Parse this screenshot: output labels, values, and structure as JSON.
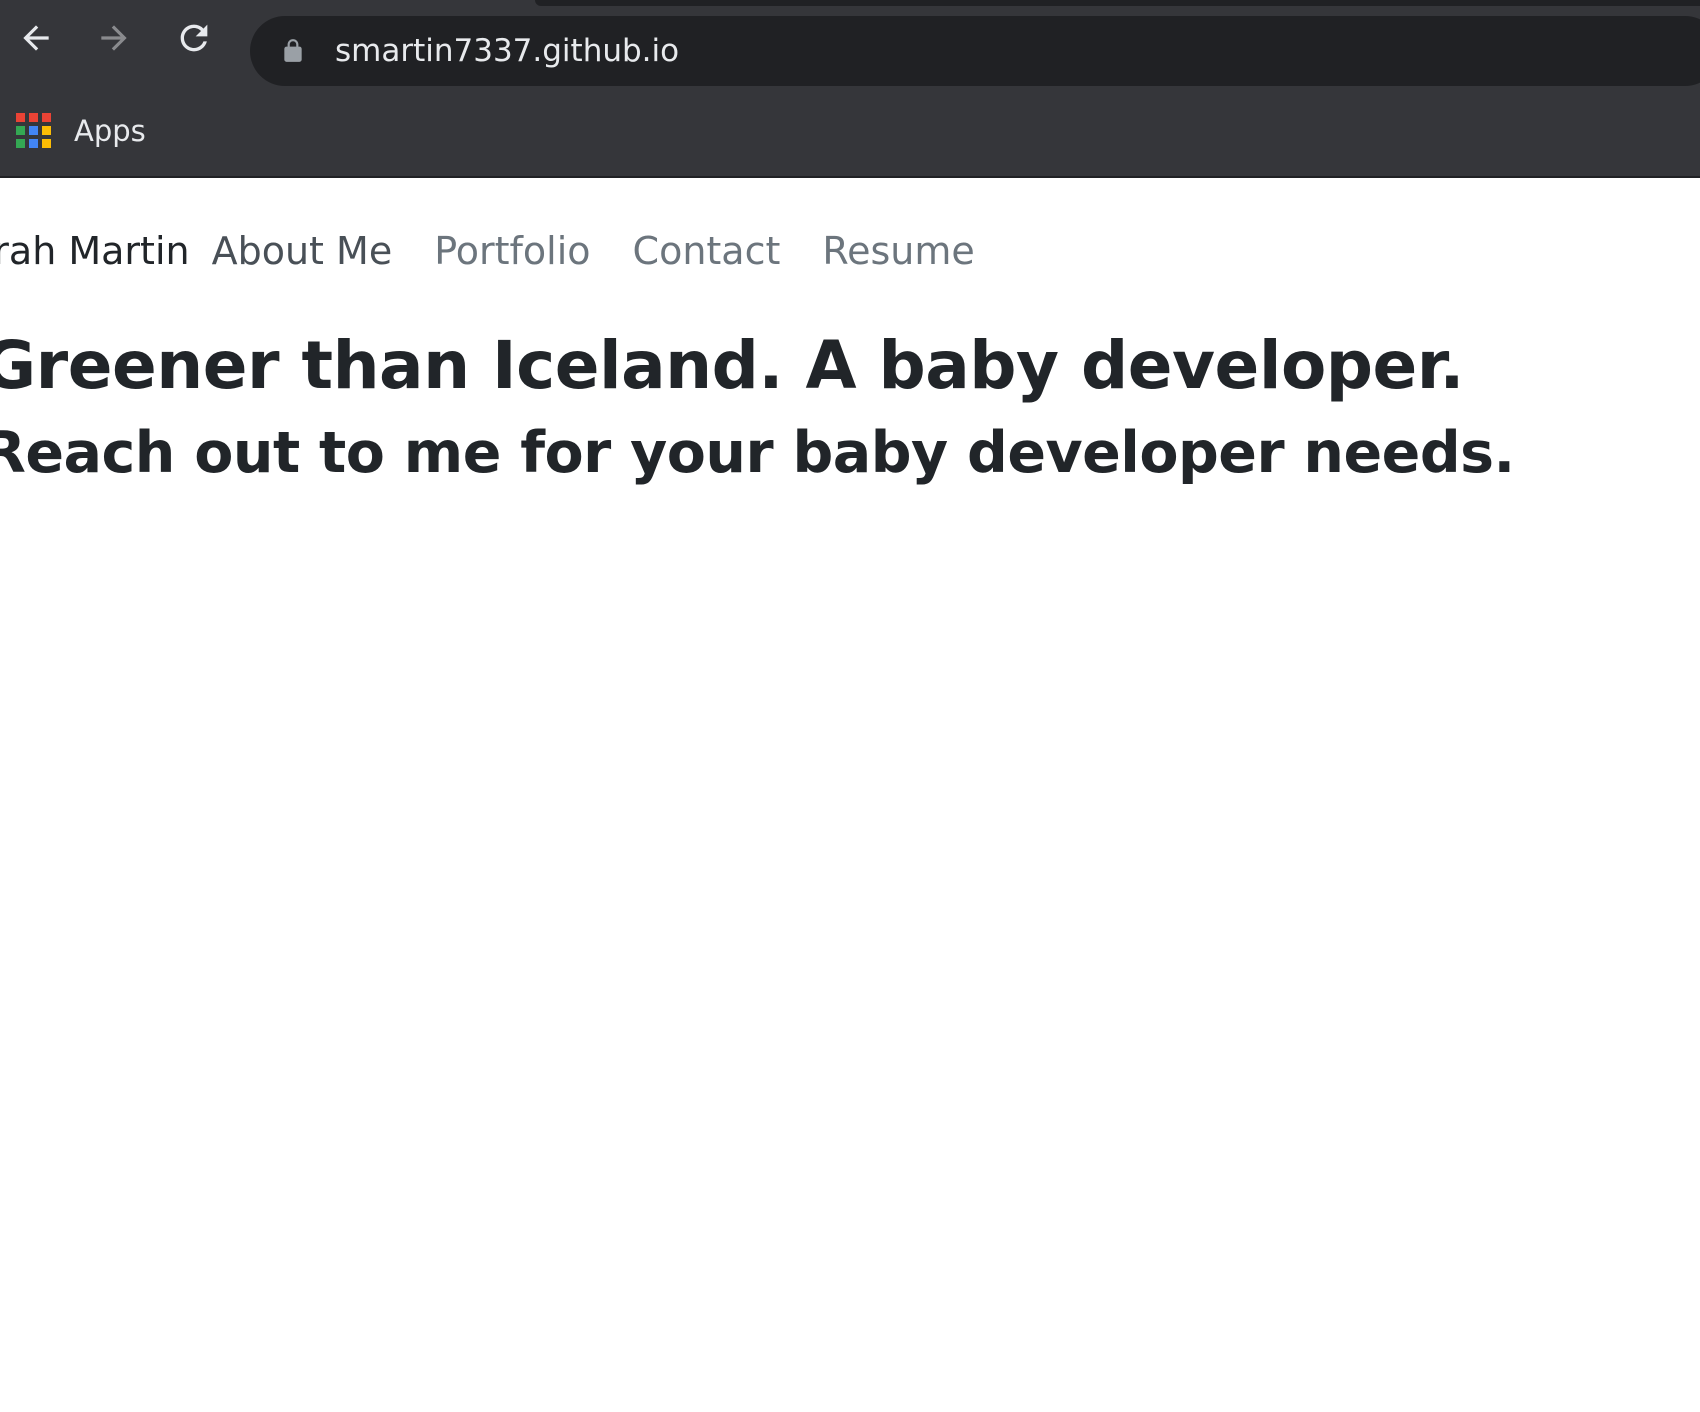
{
  "browser": {
    "url": "smartin7337.github.io",
    "bookmarks": [
      {
        "label": "Apps",
        "icon": "apps-grid-icon"
      }
    ]
  },
  "site": {
    "brand": "arah Martin",
    "nav": [
      {
        "label": "About Me"
      },
      {
        "label": "Portfolio"
      },
      {
        "label": "Contact"
      },
      {
        "label": "Resume"
      }
    ],
    "headline": "Greener than Iceland. A baby developer.",
    "subheadline": "Reach out to me for your baby developer needs."
  }
}
